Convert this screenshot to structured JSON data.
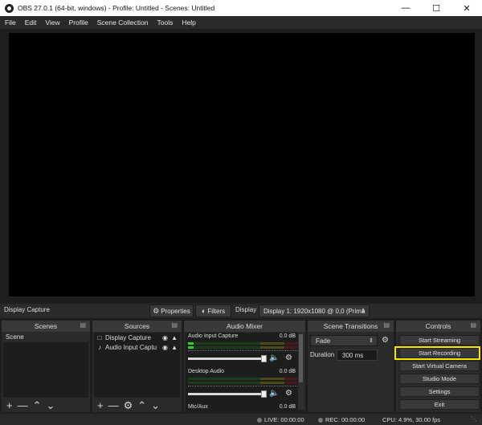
{
  "window": {
    "title": "OBS 27.0.1 (64-bit, windows) - Profile: Untitled - Scenes: Untitled",
    "minimize_icon": "minimize-icon",
    "maximize_icon": "maximize-icon",
    "close_icon": "close-icon"
  },
  "menu": [
    "File",
    "Edit",
    "View",
    "Profile",
    "Scene Collection",
    "Tools",
    "Help"
  ],
  "source_bar": {
    "source_name": "Display Capture",
    "properties_label": "Properties",
    "filters_label": "Filters",
    "display_label": "Display",
    "display_value": "Display 1: 1920x1080 @ 0,0 (Prima"
  },
  "scenes": {
    "title": "Scenes",
    "items": [
      "Scene"
    ]
  },
  "sources": {
    "title": "Sources",
    "items": [
      "Display Capture",
      "Audio Input Captu"
    ]
  },
  "mixer": {
    "title": "Audio Mixer",
    "channels": [
      {
        "name": "Audio Input Capture",
        "db": "0.0 dB",
        "level": 0.05,
        "volume": 0.7
      },
      {
        "name": "Desktop Audio",
        "db": "0.0 dB",
        "level": 0.0,
        "volume": 0.7
      },
      {
        "name": "Mic/Aux",
        "db": "0.0 dB"
      }
    ]
  },
  "transitions": {
    "title": "Scene Transitions",
    "selected": "Fade",
    "duration_label": "Duration",
    "duration_value": "300 ms"
  },
  "controls": {
    "title": "Controls",
    "buttons": [
      "Start Streaming",
      "Start Recording",
      "Start Virtual Camera",
      "Studio Mode",
      "Settings",
      "Exit"
    ],
    "highlighted": "Start Recording",
    "highlight_color": "#f5e600"
  },
  "status": {
    "live": "LIVE: 00:00:00",
    "rec": "REC: 00:00:00",
    "cpu": "CPU: 4.9%, 30.00 fps"
  }
}
